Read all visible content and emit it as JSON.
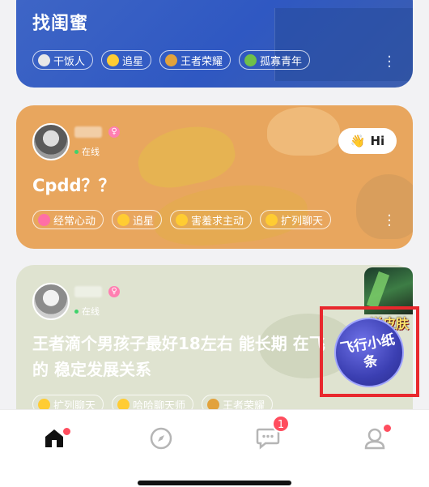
{
  "feed": {
    "card1": {
      "title": "找闺蜜",
      "tags": [
        {
          "label": "干饭人",
          "icon": "rice-bowl-icon",
          "color": "#d9d9d9"
        },
        {
          "label": "追星",
          "icon": "star-eyes-emoji-icon",
          "color": "#ffcc33"
        },
        {
          "label": "王者荣耀",
          "icon": "game-emblem-icon",
          "color": "#e2a23c"
        },
        {
          "label": "孤寡青年",
          "icon": "frog-icon",
          "color": "#6fbf4a"
        }
      ]
    },
    "card2": {
      "status": "在线",
      "hi_label": "Hi",
      "text": "Cpdd？？",
      "tags": [
        {
          "label": "经常心动",
          "icon": "heart-icon",
          "color": "#ff6fa6"
        },
        {
          "label": "追星",
          "icon": "star-eyes-emoji-icon",
          "color": "#ffcc33"
        },
        {
          "label": "害羞求主动",
          "icon": "shy-emoji-icon",
          "color": "#ffcc33"
        },
        {
          "label": "扩列聊天",
          "icon": "smile-emoji-icon",
          "color": "#ffcc33"
        }
      ]
    },
    "card3": {
      "status": "在线",
      "text": "王者滴个男孩子最好18左右 能长期 在飞的 稳定发展关系",
      "tags": [
        {
          "label": "扩列聊天",
          "icon": "smile-emoji-icon",
          "color": "#ffcc33"
        },
        {
          "label": "哈哈聊天师",
          "icon": "laugh-emoji-icon",
          "color": "#ffcc33"
        },
        {
          "label": "王者荣耀",
          "icon": "game-emblem-icon",
          "color": "#e2a23c"
        }
      ]
    }
  },
  "promo": {
    "banner": "送皮肤",
    "circle_text": "飞行小纸条"
  },
  "nav": {
    "messages_badge": "1"
  },
  "colors": {
    "accent_badge": "#ff4d5e",
    "promo_highlight": "#e8282d"
  }
}
